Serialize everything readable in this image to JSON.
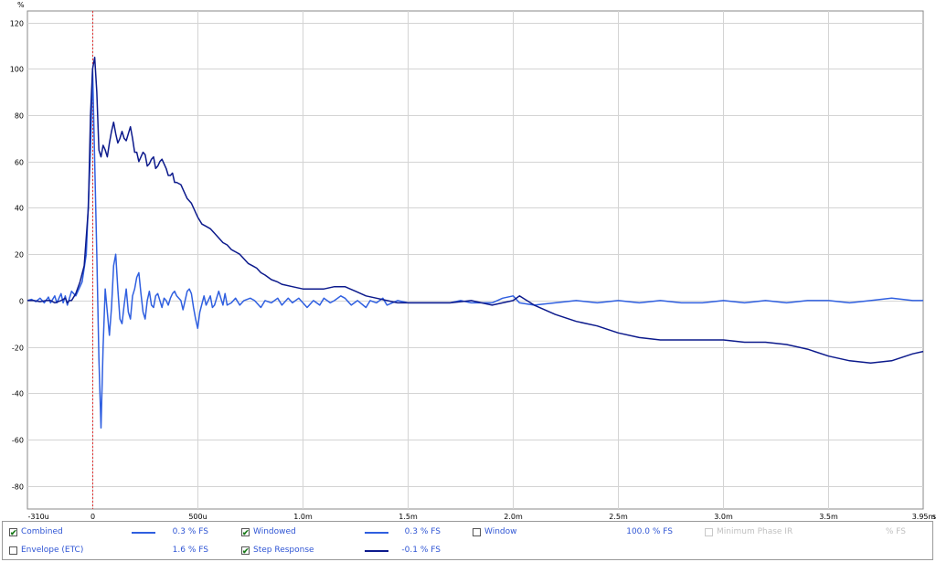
{
  "chart_data": {
    "type": "line",
    "unit_label": "%",
    "x_unit_label": "s",
    "xlim": [
      -0.00031,
      0.00395
    ],
    "ylim": [
      -90,
      125
    ],
    "x_ticks": [
      {
        "v": -0.00031,
        "label": "-310u"
      },
      {
        "v": 0,
        "label": "0"
      },
      {
        "v": 0.0005,
        "label": "500u"
      },
      {
        "v": 0.001,
        "label": "1.0m"
      },
      {
        "v": 0.0015,
        "label": "1.5m"
      },
      {
        "v": 0.002,
        "label": "2.0m"
      },
      {
        "v": 0.0025,
        "label": "2.5m"
      },
      {
        "v": 0.003,
        "label": "3.0m"
      },
      {
        "v": 0.0035,
        "label": "3.5m"
      },
      {
        "v": 0.00395,
        "label": "3.95m"
      }
    ],
    "y_ticks": [
      120,
      100,
      80,
      60,
      40,
      20,
      0,
      -20,
      -40,
      -60,
      -80
    ],
    "grid": true,
    "marker_x": 0,
    "series": [
      {
        "name": "Windowed",
        "color": "#2f5fe0",
        "points": [
          [
            -0.00031,
            0
          ],
          [
            -0.00029,
            0.5
          ],
          [
            -0.00027,
            -0.5
          ],
          [
            -0.00025,
            1
          ],
          [
            -0.00023,
            -1
          ],
          [
            -0.00021,
            1.5
          ],
          [
            -0.0002,
            -1
          ],
          [
            -0.00018,
            2
          ],
          [
            -0.00017,
            -1
          ],
          [
            -0.00015,
            3
          ],
          [
            -0.00014,
            -1
          ],
          [
            -0.00013,
            2
          ],
          [
            -0.00012,
            -2
          ],
          [
            -0.0001,
            4
          ],
          [
            -8e-05,
            2
          ],
          [
            -5e-05,
            8
          ],
          [
            -3e-05,
            20
          ],
          [
            -1e-05,
            65
          ],
          [
            0,
            100
          ],
          [
            1e-05,
            60
          ],
          [
            2e-05,
            20
          ],
          [
            3e-05,
            -25
          ],
          [
            4e-05,
            -55
          ],
          [
            5e-05,
            -20
          ],
          [
            6e-05,
            5
          ],
          [
            7e-05,
            -5
          ],
          [
            8e-05,
            -15
          ],
          [
            9e-05,
            -3
          ],
          [
            0.0001,
            15
          ],
          [
            0.00011,
            20
          ],
          [
            0.00012,
            5
          ],
          [
            0.00013,
            -8
          ],
          [
            0.00014,
            -10
          ],
          [
            0.00015,
            -2
          ],
          [
            0.00016,
            5
          ],
          [
            0.00017,
            -5
          ],
          [
            0.00018,
            -8
          ],
          [
            0.00019,
            2
          ],
          [
            0.0002,
            5
          ],
          [
            0.00021,
            10
          ],
          [
            0.00022,
            12
          ],
          [
            0.00023,
            3
          ],
          [
            0.00024,
            -5
          ],
          [
            0.00025,
            -8
          ],
          [
            0.00026,
            0
          ],
          [
            0.00027,
            4
          ],
          [
            0.00028,
            -2
          ],
          [
            0.00029,
            -3
          ],
          [
            0.0003,
            2
          ],
          [
            0.00031,
            3
          ],
          [
            0.00032,
            0
          ],
          [
            0.00033,
            -3
          ],
          [
            0.00034,
            1
          ],
          [
            0.00035,
            0
          ],
          [
            0.00036,
            -2
          ],
          [
            0.00037,
            1
          ],
          [
            0.00038,
            3
          ],
          [
            0.00039,
            4
          ],
          [
            0.0004,
            2
          ],
          [
            0.00042,
            0
          ],
          [
            0.00043,
            -4
          ],
          [
            0.00044,
            0
          ],
          [
            0.00045,
            4
          ],
          [
            0.00046,
            5
          ],
          [
            0.00047,
            3
          ],
          [
            0.00048,
            -3
          ],
          [
            0.00049,
            -8
          ],
          [
            0.0005,
            -12
          ],
          [
            0.00051,
            -5
          ],
          [
            0.00053,
            2
          ],
          [
            0.00054,
            -2
          ],
          [
            0.00055,
            0
          ],
          [
            0.00056,
            2
          ],
          [
            0.00057,
            -3
          ],
          [
            0.00058,
            -2
          ],
          [
            0.0006,
            4
          ],
          [
            0.00061,
            1
          ],
          [
            0.00062,
            -2
          ],
          [
            0.00063,
            3
          ],
          [
            0.00064,
            -2
          ],
          [
            0.00066,
            -1
          ],
          [
            0.00068,
            1
          ],
          [
            0.0007,
            -2
          ],
          [
            0.00072,
            0
          ],
          [
            0.00075,
            1
          ],
          [
            0.00077,
            0
          ],
          [
            0.0008,
            -3
          ],
          [
            0.00082,
            0
          ],
          [
            0.00085,
            -1
          ],
          [
            0.00088,
            1
          ],
          [
            0.0009,
            -2
          ],
          [
            0.00093,
            1
          ],
          [
            0.00095,
            -1
          ],
          [
            0.00098,
            1
          ],
          [
            0.001,
            -1
          ],
          [
            0.00102,
            -3
          ],
          [
            0.00105,
            0
          ],
          [
            0.00108,
            -2
          ],
          [
            0.0011,
            1
          ],
          [
            0.00113,
            -1
          ],
          [
            0.00115,
            0
          ],
          [
            0.00118,
            2
          ],
          [
            0.0012,
            1
          ],
          [
            0.00123,
            -2
          ],
          [
            0.00126,
            0
          ],
          [
            0.0013,
            -3
          ],
          [
            0.00132,
            0
          ],
          [
            0.00135,
            -1
          ],
          [
            0.00138,
            1
          ],
          [
            0.0014,
            -2
          ],
          [
            0.00145,
            0
          ],
          [
            0.0015,
            -1
          ],
          [
            0.00155,
            -1
          ],
          [
            0.0016,
            -1
          ],
          [
            0.0017,
            -1
          ],
          [
            0.00175,
            0
          ],
          [
            0.0018,
            -1
          ],
          [
            0.0019,
            -1
          ],
          [
            0.00195,
            1
          ],
          [
            0.002,
            2
          ],
          [
            0.00203,
            -1
          ],
          [
            0.0021,
            -2
          ],
          [
            0.0022,
            -1
          ],
          [
            0.0023,
            0
          ],
          [
            0.0024,
            -1
          ],
          [
            0.0025,
            0
          ],
          [
            0.0026,
            -1
          ],
          [
            0.0027,
            0
          ],
          [
            0.0028,
            -1
          ],
          [
            0.0029,
            -1
          ],
          [
            0.003,
            0
          ],
          [
            0.0031,
            -1
          ],
          [
            0.0032,
            0
          ],
          [
            0.0033,
            -1
          ],
          [
            0.0034,
            0
          ],
          [
            0.0035,
            0
          ],
          [
            0.0036,
            -1
          ],
          [
            0.0037,
            0
          ],
          [
            0.0038,
            1
          ],
          [
            0.0039,
            0
          ],
          [
            0.00395,
            0
          ]
        ]
      },
      {
        "name": "Step Response",
        "color": "#0c1a8c",
        "points": [
          [
            -0.00031,
            0
          ],
          [
            -0.00028,
            0
          ],
          [
            -0.00025,
            -0.5
          ],
          [
            -0.00022,
            0
          ],
          [
            -0.0002,
            0
          ],
          [
            -0.00018,
            -1
          ],
          [
            -0.00015,
            0
          ],
          [
            -0.00013,
            1
          ],
          [
            -0.00012,
            -1
          ],
          [
            -0.00011,
            0
          ],
          [
            -0.0001,
            0
          ],
          [
            -8e-05,
            3
          ],
          [
            -6e-05,
            8
          ],
          [
            -4e-05,
            15
          ],
          [
            -2e-05,
            40
          ],
          [
            -1e-05,
            80
          ],
          [
            0,
            100
          ],
          [
            1e-05,
            105
          ],
          [
            2e-05,
            90
          ],
          [
            3e-05,
            65
          ],
          [
            4e-05,
            62
          ],
          [
            5e-05,
            67
          ],
          [
            6e-05,
            65
          ],
          [
            7e-05,
            62
          ],
          [
            8e-05,
            68
          ],
          [
            9e-05,
            73
          ],
          [
            0.0001,
            77
          ],
          [
            0.00011,
            72
          ],
          [
            0.00012,
            68
          ],
          [
            0.00013,
            70
          ],
          [
            0.00014,
            73
          ],
          [
            0.00015,
            70
          ],
          [
            0.00016,
            69
          ],
          [
            0.00017,
            72
          ],
          [
            0.00018,
            75
          ],
          [
            0.00019,
            70
          ],
          [
            0.0002,
            64
          ],
          [
            0.00021,
            64
          ],
          [
            0.00022,
            60
          ],
          [
            0.00023,
            62
          ],
          [
            0.00024,
            64
          ],
          [
            0.00025,
            63
          ],
          [
            0.00026,
            58
          ],
          [
            0.00027,
            59
          ],
          [
            0.00028,
            61
          ],
          [
            0.00029,
            62
          ],
          [
            0.0003,
            57
          ],
          [
            0.00031,
            58
          ],
          [
            0.00032,
            60
          ],
          [
            0.00033,
            61
          ],
          [
            0.00034,
            59
          ],
          [
            0.00035,
            57
          ],
          [
            0.00036,
            54
          ],
          [
            0.00037,
            54
          ],
          [
            0.00038,
            55
          ],
          [
            0.00039,
            51
          ],
          [
            0.0004,
            51
          ],
          [
            0.00042,
            50
          ],
          [
            0.00043,
            48
          ],
          [
            0.00045,
            44
          ],
          [
            0.00047,
            42
          ],
          [
            0.00048,
            40
          ],
          [
            0.0005,
            36
          ],
          [
            0.00052,
            33
          ],
          [
            0.00054,
            32
          ],
          [
            0.00056,
            31
          ],
          [
            0.00058,
            29
          ],
          [
            0.0006,
            27
          ],
          [
            0.00062,
            25
          ],
          [
            0.00064,
            24
          ],
          [
            0.00066,
            22
          ],
          [
            0.00068,
            21
          ],
          [
            0.0007,
            20
          ],
          [
            0.00072,
            18
          ],
          [
            0.00074,
            16
          ],
          [
            0.00076,
            15
          ],
          [
            0.00078,
            14
          ],
          [
            0.0008,
            12
          ],
          [
            0.00082,
            11
          ],
          [
            0.00085,
            9
          ],
          [
            0.00088,
            8
          ],
          [
            0.0009,
            7
          ],
          [
            0.00095,
            6
          ],
          [
            0.001,
            5
          ],
          [
            0.00105,
            5
          ],
          [
            0.0011,
            5
          ],
          [
            0.00115,
            6
          ],
          [
            0.0012,
            6
          ],
          [
            0.00125,
            4
          ],
          [
            0.0013,
            2
          ],
          [
            0.00135,
            1
          ],
          [
            0.0014,
            0
          ],
          [
            0.00145,
            -1
          ],
          [
            0.0015,
            -1
          ],
          [
            0.0016,
            -1
          ],
          [
            0.0017,
            -1
          ],
          [
            0.0018,
            0
          ],
          [
            0.00185,
            -1
          ],
          [
            0.0019,
            -2
          ],
          [
            0.00195,
            -1
          ],
          [
            0.002,
            0
          ],
          [
            0.00203,
            2
          ],
          [
            0.0021,
            -2
          ],
          [
            0.0022,
            -6
          ],
          [
            0.0023,
            -9
          ],
          [
            0.0024,
            -11
          ],
          [
            0.0025,
            -14
          ],
          [
            0.0026,
            -16
          ],
          [
            0.0027,
            -17
          ],
          [
            0.0028,
            -17
          ],
          [
            0.0029,
            -17
          ],
          [
            0.003,
            -17
          ],
          [
            0.0031,
            -18
          ],
          [
            0.0032,
            -18
          ],
          [
            0.0033,
            -19
          ],
          [
            0.0034,
            -21
          ],
          [
            0.0035,
            -24
          ],
          [
            0.0036,
            -26
          ],
          [
            0.0037,
            -27
          ],
          [
            0.0038,
            -26
          ],
          [
            0.0039,
            -23
          ],
          [
            0.00395,
            -22
          ]
        ]
      }
    ]
  },
  "legend": {
    "row1": [
      {
        "label": "Combined",
        "checked": true,
        "enabled": true,
        "swatch": "#2f5fe0",
        "value": "0.3 % FS"
      },
      {
        "label": "Windowed",
        "checked": true,
        "enabled": true,
        "swatch": "#2f5fe0",
        "value": "0.3 % FS"
      },
      {
        "label": "Window",
        "checked": false,
        "enabled": true,
        "swatch": "",
        "value": "100.0 % FS"
      },
      {
        "label": "Minimum Phase IR",
        "checked": false,
        "enabled": false,
        "swatch": "",
        "value": "% FS"
      }
    ],
    "row2": [
      {
        "label": "Envelope (ETC)",
        "checked": false,
        "enabled": true,
        "swatch": "",
        "value": "1.6 % FS"
      },
      {
        "label": "Step Response",
        "checked": true,
        "enabled": true,
        "swatch": "#0c1a8c",
        "value": "-0.1 % FS"
      }
    ]
  }
}
